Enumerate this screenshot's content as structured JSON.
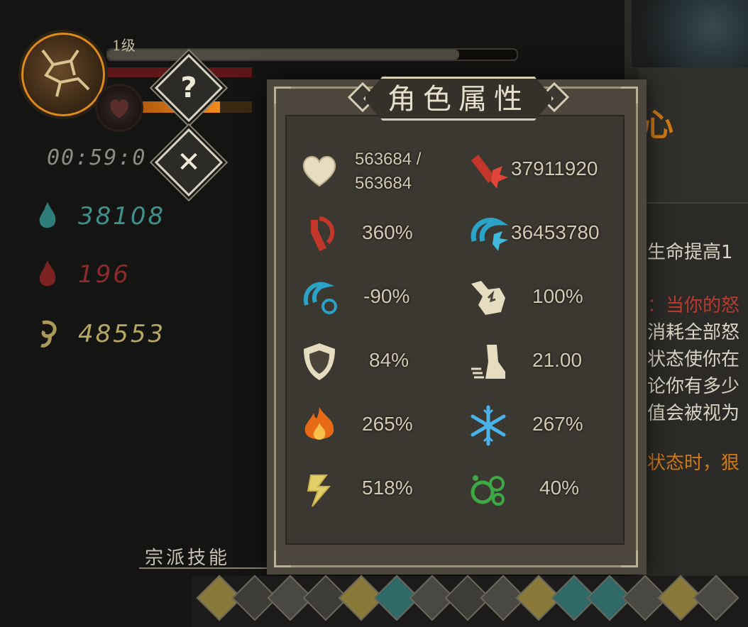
{
  "hud": {
    "level_label": "1级",
    "hp_fraction": 0.86,
    "energy_fraction": 0.72,
    "timer": "00:59:0",
    "resources": [
      {
        "icon": "blue-flame-icon",
        "value": "38108",
        "color": "#3f8f8c"
      },
      {
        "icon": "red-flame-icon",
        "value": "196",
        "color": "#8c2b2b"
      },
      {
        "icon": "yellow-spirit-icon",
        "value": "48553",
        "color": "#b6a860"
      }
    ],
    "help_button": "?",
    "close_button": "✕",
    "sect_skills_label": "宗派技能"
  },
  "modal": {
    "title": "角色属性",
    "stats_left": [
      {
        "icon": "heart-icon",
        "value": "563684 / 563684"
      },
      {
        "icon": "crit-rate-icon",
        "value": "360%"
      },
      {
        "icon": "cooldown-icon",
        "value": "-90%"
      },
      {
        "icon": "shield-icon",
        "value": "84%"
      },
      {
        "icon": "fire-icon",
        "value": "265%"
      },
      {
        "icon": "lightning-icon",
        "value": "518%"
      }
    ],
    "stats_right": [
      {
        "icon": "attack-icon",
        "value": "37911920"
      },
      {
        "icon": "magic-attack-icon",
        "value": "36453780"
      },
      {
        "icon": "strength-icon",
        "value": "100%"
      },
      {
        "icon": "speed-icon",
        "value": "21.00"
      },
      {
        "icon": "ice-icon",
        "value": "267%"
      },
      {
        "icon": "poison-icon",
        "value": "40%"
      }
    ]
  },
  "side_panel": {
    "title": "心",
    "lines": [
      "生命提高1",
      "：当你的怒",
      "消耗全部怒",
      "状态使你在",
      "论你有多少",
      "值会被视为",
      "状态时，狠"
    ]
  }
}
